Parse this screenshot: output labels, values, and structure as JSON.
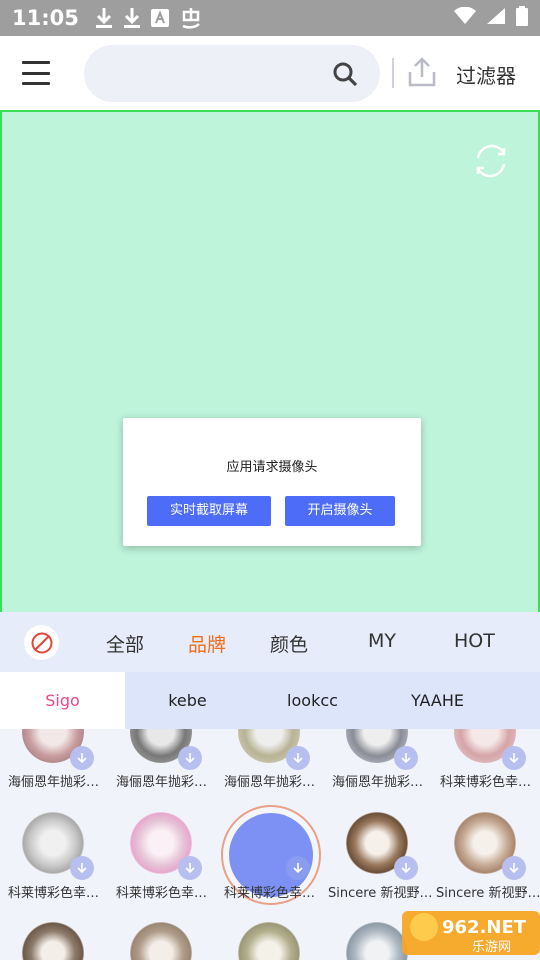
{
  "status": {
    "time": "11:05",
    "notif_icons": [
      "download-icon",
      "download-icon",
      "font-a-icon",
      "bug-icon"
    ],
    "right_icons": [
      "wifi-icon",
      "signal-icon",
      "battery-icon"
    ]
  },
  "toolbar": {
    "search_placeholder": "",
    "filter_label": "过滤器"
  },
  "dialog": {
    "title": "应用请求摄像头",
    "btn_screen": "实时截取屏幕",
    "btn_camera": "开启摄像头"
  },
  "categories": [
    "全部",
    "品牌",
    "颜色",
    "MY",
    "HOT"
  ],
  "category_active": "品牌",
  "brands": [
    "Sigo",
    "kebe",
    "lookcc",
    "YAAHE"
  ],
  "brand_active": "Sigo",
  "grid": {
    "row1": [
      "海俪恩年抛彩…",
      "海俪恩年抛彩…",
      "海俪恩年抛彩…",
      "海俪恩年抛彩…",
      "科莱博彩色幸…"
    ],
    "row2": [
      "科莱博彩色幸…",
      "科莱博彩色幸…",
      "科莱博彩色幸…",
      "Sincere 新视野…",
      "Sincere 新视野…"
    ]
  },
  "watermark": {
    "text_top": "962.NET",
    "text_bottom": "乐游网"
  },
  "colors": {
    "accent": "#4d6cf7",
    "active_category": "#f06d1b",
    "active_brand": "#e8478a",
    "camera_bg": "#bdf4da"
  }
}
